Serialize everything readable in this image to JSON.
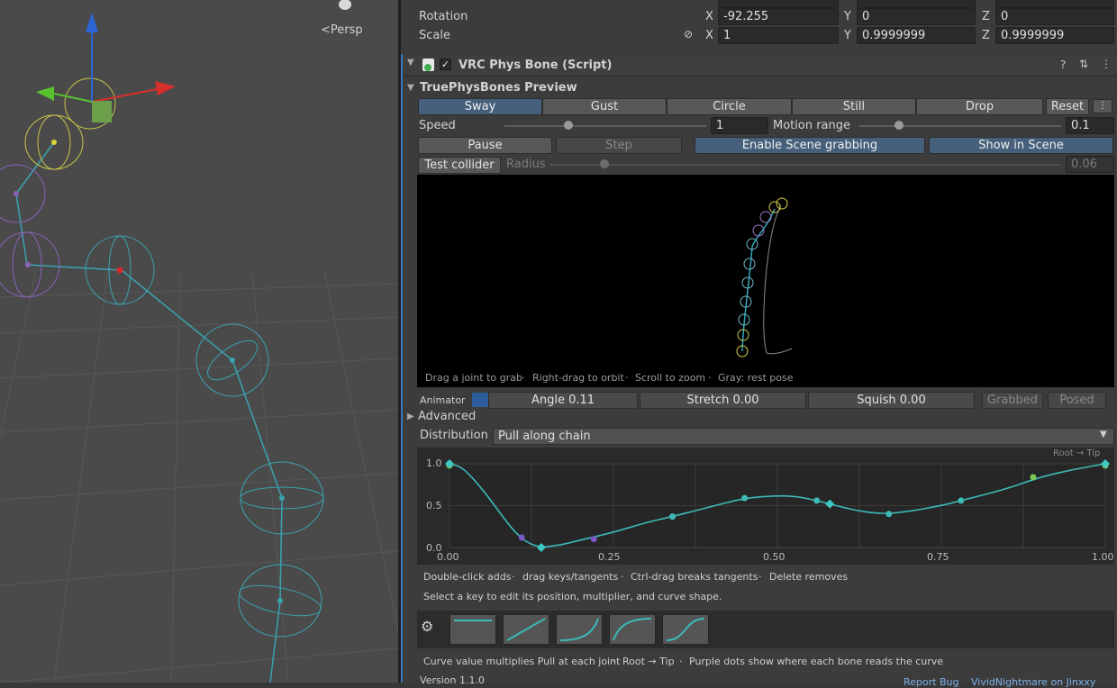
{
  "scene": {
    "persp_label": "Persp",
    "colors": {
      "background": "#4a4a4a",
      "bone": "#3aa3b0",
      "axis_x": "#d6302c",
      "axis_y": "#58c12e",
      "axis_z": "#2a66d8"
    }
  },
  "transform": {
    "rotation": {
      "label": "Rotation",
      "x": "-92.255",
      "y": "0",
      "z": "0"
    },
    "scale": {
      "label": "Scale",
      "x": "1",
      "y": "0.9999999",
      "z": "0.9999999"
    },
    "axis_labels": {
      "x": "X",
      "y": "Y",
      "z": "Z"
    },
    "link_icon": "link-icon"
  },
  "component": {
    "title": "VRC Phys Bone (Script)",
    "enabled": true,
    "header_icons": [
      "help-icon",
      "preset-icon",
      "kebab-icon"
    ]
  },
  "preview_section": {
    "title": "TruePhysBones Preview",
    "modes": [
      "Sway",
      "Gust",
      "Circle",
      "Still",
      "Drop"
    ],
    "active_mode": "Sway",
    "reset_label": "Reset",
    "speed": {
      "label": "Speed",
      "value": "1",
      "slider_fraction": 0.32
    },
    "motion_range": {
      "label": "Motion range",
      "value": "0.1",
      "slider_fraction": 0.19
    },
    "pause_label": "Pause",
    "step_label": "Step",
    "scene_grab_label": "Enable Scene grabbing",
    "show_scene_label": "Show in Scene",
    "test_collider_label": "Test collider",
    "radius": {
      "label": "Radius",
      "value": "0.06",
      "slider_fraction": 0.1
    },
    "hints": [
      "Drag a joint to grab",
      "Right-drag to orbit",
      "Scroll to zoom",
      "Gray: rest pose"
    ],
    "hint_separator": "·"
  },
  "animator": {
    "label": "Animator",
    "angle": "Angle 0.11",
    "stretch": "Stretch 0.00",
    "squish": "Squish 0.00",
    "grabbed_label": "Grabbed",
    "posed_label": "Posed"
  },
  "advanced": {
    "label": "Advanced"
  },
  "distribution": {
    "label": "Distribution",
    "value": "Pull along chain",
    "dropdown_icon": "triangle-down-icon"
  },
  "curve": {
    "corner_label": "Root → Tip",
    "y_ticks": [
      "1.0",
      "0.5",
      "0.0"
    ],
    "x_ticks": [
      "0.00",
      "0.25",
      "0.50",
      "0.75",
      "1.00"
    ],
    "colors": {
      "curve": "#3cbab8",
      "keys": "#3fc9c4",
      "bone_dots": "#7b56c6",
      "green_dots": "#7ec857",
      "grid": "#3c3c3c"
    },
    "help_line1": [
      "Double-click adds",
      "drag keys/tangents",
      "Ctrl-drag breaks tangents",
      "Delete removes"
    ],
    "help_line2": "Select a key to edit its position, multiplier, and curve shape.",
    "presets_icon": "gear-icon",
    "footer": [
      "Curve value multiplies Pull at each joint",
      "Root → Tip",
      "Purple dots show where each bone reads the curve"
    ]
  },
  "chart_data": {
    "type": "line",
    "title": "",
    "xlabel": "",
    "ylabel": "",
    "xlim": [
      0,
      1
    ],
    "ylim": [
      0,
      1
    ],
    "keys": [
      {
        "x": 0.0,
        "y": 1.0
      },
      {
        "x": 0.14,
        "y": 0.0
      },
      {
        "x": 0.58,
        "y": 0.52
      },
      {
        "x": 1.0,
        "y": 1.0
      }
    ],
    "curve": {
      "x": [
        0.0,
        0.02,
        0.05,
        0.08,
        0.1,
        0.12,
        0.14,
        0.17,
        0.2,
        0.25,
        0.3,
        0.34,
        0.4,
        0.45,
        0.5,
        0.53,
        0.56,
        0.58,
        0.62,
        0.66,
        0.7,
        0.75,
        0.78,
        0.85,
        0.9,
        0.95,
        1.0
      ],
      "y": [
        1.0,
        0.96,
        0.7,
        0.38,
        0.18,
        0.05,
        0.0,
        0.03,
        0.09,
        0.18,
        0.3,
        0.37,
        0.49,
        0.59,
        0.62,
        0.61,
        0.56,
        0.52,
        0.44,
        0.4,
        0.43,
        0.5,
        0.56,
        0.7,
        0.84,
        0.93,
        1.0
      ]
    },
    "sample_points": [
      {
        "x": 0.0,
        "y": 0.98,
        "kind": "green"
      },
      {
        "x": 0.11,
        "y": 0.12,
        "kind": "purple"
      },
      {
        "x": 0.22,
        "y": 0.1,
        "kind": "purple"
      },
      {
        "x": 0.34,
        "y": 0.37,
        "kind": "teal"
      },
      {
        "x": 0.45,
        "y": 0.59,
        "kind": "teal"
      },
      {
        "x": 0.56,
        "y": 0.56,
        "kind": "teal"
      },
      {
        "x": 0.67,
        "y": 0.4,
        "kind": "teal"
      },
      {
        "x": 0.78,
        "y": 0.56,
        "kind": "teal"
      },
      {
        "x": 0.89,
        "y": 0.84,
        "kind": "green"
      },
      {
        "x": 1.0,
        "y": 0.98,
        "kind": "green"
      }
    ]
  },
  "footer": {
    "version": "Version 1.1.0",
    "report_label": "Report Bug",
    "credit": "VividNightmare on Jinxxy"
  }
}
